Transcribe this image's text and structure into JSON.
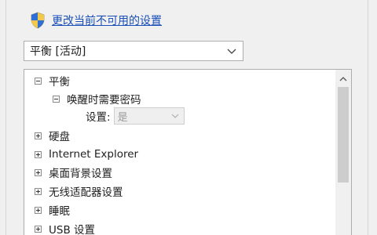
{
  "link": {
    "text": "更改当前不可用的设置",
    "icon": "uac-shield-icon"
  },
  "plan_select": {
    "value": "平衡 [活动]",
    "icon": "chevron-down-icon"
  },
  "tree": {
    "root": {
      "label": "平衡",
      "state": "expanded"
    },
    "child": {
      "label": "唤醒时需要密码",
      "state": "expanded"
    },
    "setting": {
      "label": "设置:",
      "value": "是",
      "disabled": true
    },
    "items": [
      {
        "label": "硬盘",
        "state": "collapsed"
      },
      {
        "label": "Internet Explorer",
        "state": "collapsed"
      },
      {
        "label": "桌面背景设置",
        "state": "collapsed"
      },
      {
        "label": "无线适配器设置",
        "state": "collapsed"
      },
      {
        "label": "睡眠",
        "state": "collapsed"
      },
      {
        "label": "USB 设置",
        "state": "collapsed"
      }
    ]
  },
  "colors": {
    "link": "#1a4fb8",
    "background": "#f0f0f0",
    "panel": "#ffffff",
    "border": "#adadad",
    "disabled_text": "#9a9a9a"
  }
}
